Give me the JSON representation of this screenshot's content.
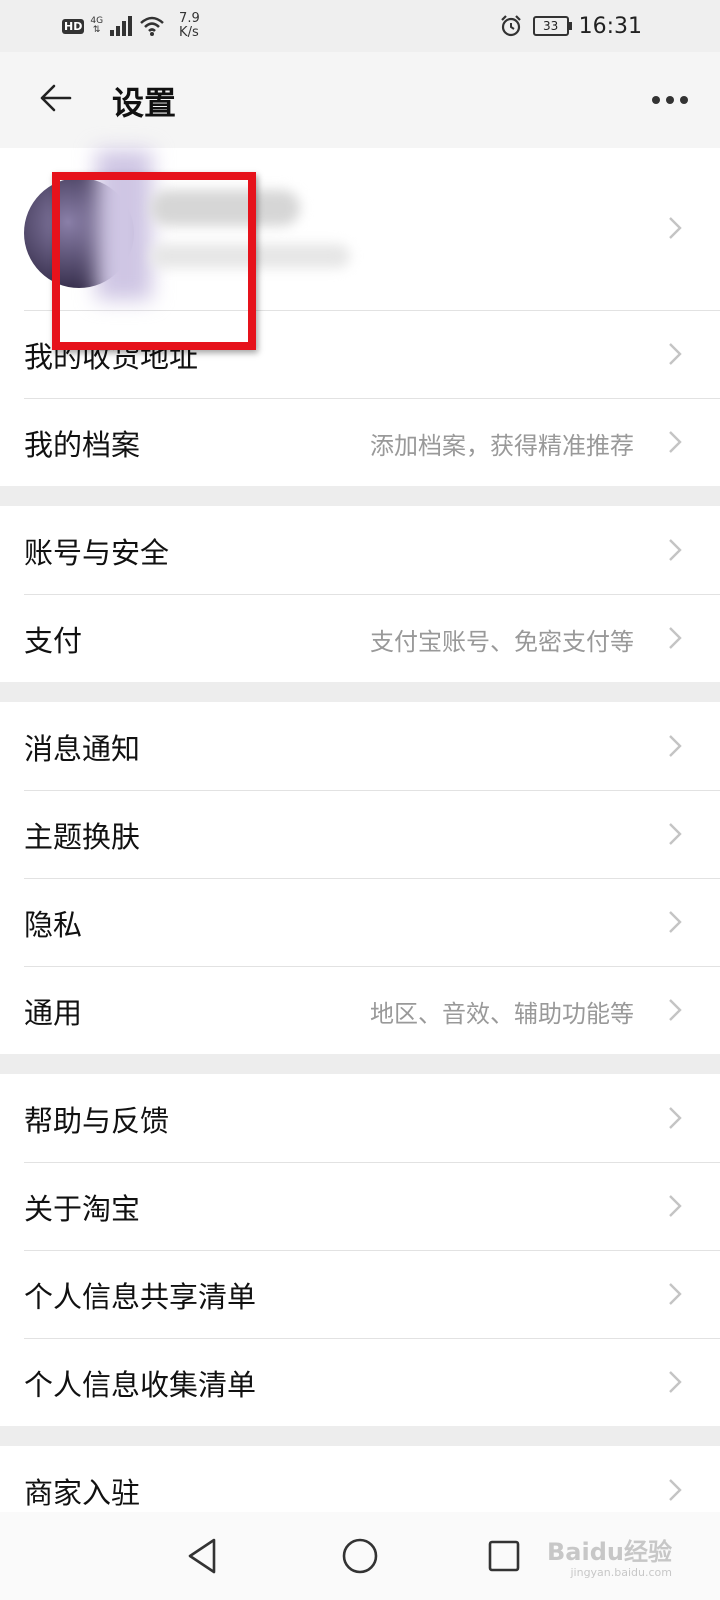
{
  "status_bar": {
    "hd": "HD",
    "network": "4G",
    "speed_value": "7.9",
    "speed_unit": "K/s",
    "battery": "33",
    "time": "16:31"
  },
  "header": {
    "title": "设置"
  },
  "sections": [
    {
      "items": [
        {
          "label": "我的收货地址",
          "desc": ""
        },
        {
          "label": "我的档案",
          "desc": "添加档案，获得精准推荐"
        }
      ]
    },
    {
      "items": [
        {
          "label": "账号与安全",
          "desc": ""
        },
        {
          "label": "支付",
          "desc": "支付宝账号、免密支付等"
        }
      ]
    },
    {
      "items": [
        {
          "label": "消息通知",
          "desc": ""
        },
        {
          "label": "主题换肤",
          "desc": ""
        },
        {
          "label": "隐私",
          "desc": ""
        },
        {
          "label": "通用",
          "desc": "地区、音效、辅助功能等"
        }
      ]
    },
    {
      "items": [
        {
          "label": "帮助与反馈",
          "desc": ""
        },
        {
          "label": "关于淘宝",
          "desc": ""
        },
        {
          "label": "个人信息共享清单",
          "desc": ""
        },
        {
          "label": "个人信息收集清单",
          "desc": ""
        }
      ]
    },
    {
      "items": [
        {
          "label": "商家入驻",
          "desc": ""
        }
      ]
    }
  ],
  "watermark": {
    "text": "Baidu经验",
    "sub": "jingyan.baidu.com"
  },
  "colors": {
    "highlight": "#e6121b",
    "background": "#ededed"
  }
}
